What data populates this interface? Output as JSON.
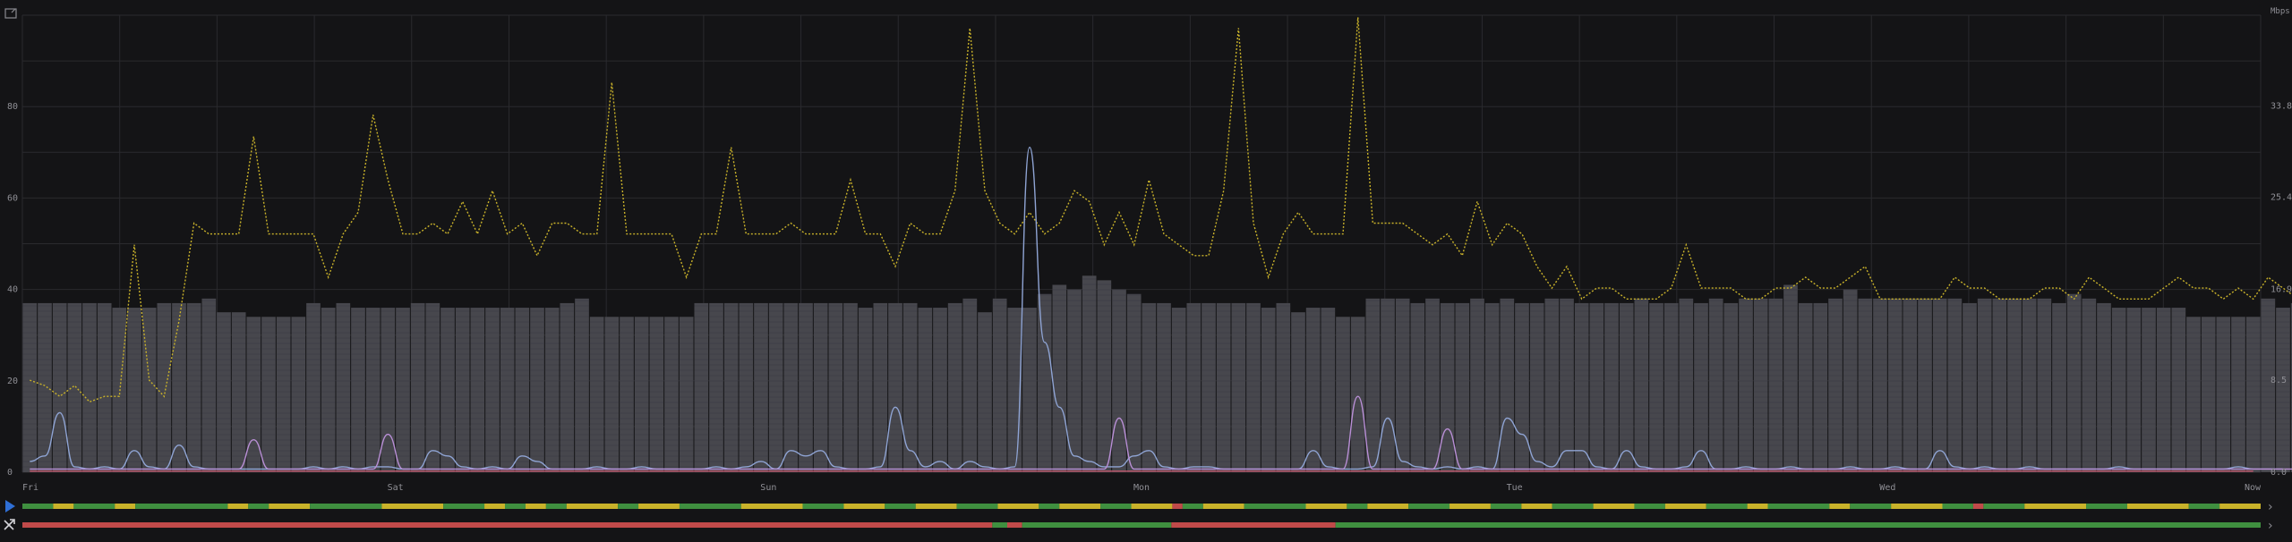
{
  "chart_data": {
    "type": "line",
    "x_labels": [
      "Fri",
      "Sat",
      "Sun",
      "Mon",
      "Tue",
      "Wed",
      "Now"
    ],
    "y_left": {
      "ticks": [
        "0",
        "20",
        "40",
        "60",
        "80"
      ],
      "range": [
        0,
        100
      ]
    },
    "y_right": {
      "label": "Mbps",
      "ticks": [
        "0.0",
        "8.5",
        "16.9",
        "25.4",
        "33.8"
      ],
      "range": [
        0,
        42.2
      ]
    },
    "grid": true,
    "n_points": 150,
    "series": [
      {
        "kind": "bars",
        "axis": "left",
        "color": "#47474d",
        "values": [
          37,
          37,
          37,
          37,
          37,
          37,
          36,
          36,
          36,
          37,
          37,
          37,
          38,
          35,
          35,
          34,
          34,
          34,
          34,
          37,
          36,
          37,
          36,
          36,
          36,
          36,
          37,
          37,
          36,
          36,
          36,
          36,
          36,
          36,
          36,
          36,
          37,
          38,
          34,
          34,
          34,
          34,
          34,
          34,
          34,
          37,
          37,
          37,
          37,
          37,
          37,
          37,
          37,
          37,
          37,
          37,
          36,
          37,
          37,
          37,
          36,
          36,
          37,
          38,
          35,
          38,
          36,
          36,
          39,
          41,
          40,
          43,
          42,
          40,
          39,
          37,
          37,
          36,
          37,
          37,
          37,
          37,
          37,
          36,
          37,
          35,
          36,
          36,
          34,
          34,
          38,
          38,
          38,
          37,
          38,
          37,
          37,
          38,
          37,
          38,
          37,
          37,
          38,
          38,
          37,
          37,
          37,
          37,
          38,
          37,
          37,
          38,
          37,
          38,
          37,
          38,
          38,
          38,
          41,
          37,
          37,
          38,
          40,
          38,
          38,
          38,
          38,
          38,
          38,
          38,
          37,
          38,
          38,
          38,
          38,
          38,
          37,
          39,
          38,
          37,
          36,
          36,
          36,
          36,
          36,
          34,
          34,
          34,
          34,
          34,
          38,
          36,
          37,
          37,
          37,
          37,
          37,
          37
        ]
      },
      {
        "kind": "line",
        "style": "dotted",
        "axis": "right",
        "color": "#c9b22a",
        "values": [
          8.5,
          8,
          7,
          8,
          6.5,
          7,
          7,
          21,
          8.5,
          7,
          14,
          23,
          22,
          22,
          22,
          31,
          22,
          22,
          22,
          22,
          18,
          22,
          24,
          33,
          27,
          22,
          22,
          23,
          22,
          25,
          22,
          26,
          22,
          23,
          20,
          23,
          23,
          22,
          22,
          36,
          22,
          22,
          22,
          22,
          18,
          22,
          22,
          30,
          22,
          22,
          22,
          23,
          22,
          22,
          22,
          27,
          22,
          22,
          19,
          23,
          22,
          22,
          26,
          41,
          26,
          23,
          22,
          24,
          22,
          23,
          26,
          25,
          21,
          24,
          21,
          27,
          22,
          21,
          20,
          20,
          26,
          41,
          23,
          18,
          22,
          24,
          22,
          22,
          22,
          42,
          23,
          23,
          23,
          22,
          21,
          22,
          20,
          25,
          21,
          23,
          22,
          19,
          17,
          19,
          16,
          17,
          17,
          16,
          16,
          16,
          17,
          21,
          17,
          17,
          17,
          16,
          16,
          17,
          17,
          18,
          17,
          17,
          18,
          19,
          16,
          16,
          16,
          16,
          16,
          18,
          17,
          17,
          16,
          16,
          16,
          17,
          17,
          16,
          18,
          17,
          16,
          16,
          16,
          17,
          18,
          17,
          17,
          16,
          17,
          16,
          18,
          17,
          16,
          15,
          16,
          17
        ]
      },
      {
        "kind": "line",
        "style": "solid",
        "axis": "right",
        "color": "#8fa4d4",
        "values": [
          1,
          1.5,
          5.5,
          0.5,
          0.3,
          0.5,
          0.3,
          2,
          0.5,
          0.3,
          2.5,
          0.5,
          0.3,
          0.3,
          0.3,
          0.3,
          0.3,
          0.3,
          0.3,
          0.5,
          0.3,
          0.5,
          0.3,
          0.5,
          0.5,
          0.3,
          0.3,
          2,
          1.5,
          0.5,
          0.3,
          0.5,
          0.3,
          1.5,
          1,
          0.3,
          0.3,
          0.3,
          0.5,
          0.3,
          0.3,
          0.5,
          0.3,
          0.3,
          0.3,
          0.3,
          0.5,
          0.3,
          0.5,
          1,
          0.3,
          2,
          1.5,
          2,
          0.5,
          0.3,
          0.3,
          0.5,
          6,
          2,
          0.5,
          1,
          0.3,
          1,
          0.5,
          0.3,
          0.5,
          30,
          12,
          6,
          1.5,
          1,
          0.5,
          0.5,
          1.5,
          2,
          0.5,
          0.3,
          0.5,
          0.5,
          0.3,
          0.3,
          0.3,
          0.3,
          0.3,
          0.3,
          2,
          0.5,
          0.3,
          0.3,
          0.5,
          5,
          1,
          0.5,
          0.3,
          0.5,
          0.3,
          0.5,
          0.3,
          5,
          3.5,
          1,
          0.5,
          2,
          2,
          0.5,
          0.3,
          2,
          0.5,
          0.3,
          0.3,
          0.5,
          2,
          0.3,
          0.3,
          0.5,
          0.3,
          0.3,
          0.5,
          0.3,
          0.3,
          0.3,
          0.5,
          0.3,
          0.3,
          0.5,
          0.3,
          0.3,
          2,
          0.5,
          0.3,
          0.5,
          0.3,
          0.3,
          0.5,
          0.3,
          0.3,
          0.3,
          0.3,
          0.3,
          0.5,
          0.3,
          0.3,
          0.3,
          0.3,
          0.3,
          0.3,
          0.3,
          0.5,
          0.3,
          0.3,
          0.3
        ]
      },
      {
        "kind": "line",
        "style": "solid",
        "axis": "right",
        "color": "#b98fd6",
        "values": [
          0.3,
          0.3,
          0.3,
          0.3,
          0.3,
          0.3,
          0.3,
          0.3,
          0.3,
          0.3,
          0.3,
          0.3,
          0.3,
          0.3,
          0.3,
          3,
          0.3,
          0.3,
          0.3,
          0.3,
          0.3,
          0.3,
          0.3,
          0.3,
          3.5,
          0.3,
          0.3,
          0.3,
          0.3,
          0.3,
          0.3,
          0.3,
          0.3,
          0.3,
          0.3,
          0.3,
          0.3,
          0.3,
          0.3,
          0.3,
          0.3,
          0.3,
          0.3,
          0.3,
          0.3,
          0.3,
          0.3,
          0.3,
          0.3,
          0.3,
          0.3,
          0.3,
          0.3,
          0.3,
          0.3,
          0.3,
          0.3,
          0.3,
          0.3,
          0.3,
          0.3,
          0.3,
          0.3,
          0.3,
          0.3,
          0.3,
          0.3,
          0.3,
          0.3,
          0.3,
          0.3,
          0.3,
          0.3,
          5,
          0.3,
          0.3,
          0.3,
          0.3,
          0.3,
          0.3,
          0.3,
          0.3,
          0.3,
          0.3,
          0.3,
          0.3,
          0.3,
          0.3,
          0.3,
          7,
          0.3,
          0.3,
          0.3,
          0.3,
          0.3,
          4,
          0.3,
          0.3,
          0.3,
          0.3,
          0.3,
          0.3,
          0.3,
          0.3,
          0.3,
          0.3,
          0.3,
          0.3,
          0.3,
          0.3,
          0.3,
          0.3,
          0.3,
          0.3,
          0.3,
          0.3,
          0.3,
          0.3,
          0.3,
          0.3,
          0.3,
          0.3,
          0.3,
          0.3,
          0.3,
          0.3,
          0.3,
          0.3,
          0.3,
          0.3,
          0.3,
          0.3,
          0.3,
          0.3,
          0.3,
          0.3,
          0.3,
          0.3,
          0.3,
          0.3,
          0.3,
          0.3,
          0.3,
          0.3,
          0.3,
          0.3,
          0.3,
          0.3,
          0.3,
          0.3,
          0.3,
          0.3,
          0.3
        ]
      },
      {
        "kind": "line",
        "style": "solid",
        "axis": "right",
        "color": "#c0566a",
        "values": [
          0.1,
          0.1,
          0.1,
          0.1,
          0.1,
          0.1,
          0.1,
          0.1,
          0.1,
          0.1,
          0.1,
          0.1,
          0.1,
          0.1,
          0.1,
          0.1,
          0.1,
          0.1,
          0.1,
          0.1,
          0.1,
          0.1,
          0.1,
          0.1,
          0.1,
          0.1,
          0.1,
          0.1,
          0.1,
          0.1,
          0.1,
          0.1,
          0.1,
          0.1,
          0.1,
          0.1,
          0.1,
          0.1,
          0.1,
          0.1,
          0.1,
          0.1,
          0.1,
          0.1,
          0.1,
          0.1,
          0.1,
          0.1,
          0.1,
          0.1,
          0.1,
          0.1,
          0.1,
          0.1,
          0.1,
          0.1,
          0.1,
          0.1,
          0.1,
          0.1,
          0.1,
          0.1,
          0.1,
          0.1,
          0.1,
          0.1,
          0.1,
          0.1,
          0.1,
          0.1,
          0.1,
          0.1,
          0.1,
          0.1,
          0.1,
          0.1,
          0.1,
          0.1,
          0.1,
          0.1,
          0.1,
          0.1,
          0.1,
          0.1,
          0.1,
          0.1,
          0.1,
          0.1,
          0.1,
          0.1,
          0.1,
          0.1,
          0.1,
          0.1,
          0.1,
          0.1,
          0.1,
          0.1,
          0.1,
          0.1,
          0.1,
          0.1,
          0.1,
          0.1,
          0.1,
          0.1,
          0.1,
          0.1,
          0.1,
          0.1,
          0.1,
          0.1,
          0.1,
          0.1,
          0.1,
          0.1,
          0.1,
          0.1,
          0.1,
          0.1,
          0.1,
          0.1,
          0.1,
          0.1,
          0.1,
          0.1,
          0.1,
          0.1,
          0.1,
          0.1,
          0.1,
          0.1,
          0.1,
          0.1,
          0.1,
          0.1,
          0.1,
          0.1,
          0.1,
          0.1,
          0.1,
          0.1,
          0.1,
          0.1,
          0.1,
          0.1,
          0.1,
          0.1,
          0.1,
          0.1
        ]
      }
    ],
    "status_lanes": [
      {
        "icon": "play-icon",
        "icon_color": "#2f6fd6",
        "segments": [
          [
            "#3f8f3f",
            3
          ],
          [
            "#c9b22a",
            2
          ],
          [
            "#3f8f3f",
            4
          ],
          [
            "#c9b22a",
            2
          ],
          [
            "#3f8f3f",
            9
          ],
          [
            "#c9b22a",
            2
          ],
          [
            "#3f8f3f",
            2
          ],
          [
            "#c9b22a",
            4
          ],
          [
            "#3f8f3f",
            7
          ],
          [
            "#c9b22a",
            6
          ],
          [
            "#3f8f3f",
            4
          ],
          [
            "#c9b22a",
            2
          ],
          [
            "#3f8f3f",
            2
          ],
          [
            "#c9b22a",
            2
          ],
          [
            "#3f8f3f",
            2
          ],
          [
            "#c9b22a",
            5
          ],
          [
            "#3f8f3f",
            2
          ],
          [
            "#c9b22a",
            4
          ],
          [
            "#3f8f3f",
            6
          ],
          [
            "#c9b22a",
            6
          ],
          [
            "#3f8f3f",
            4
          ],
          [
            "#c9b22a",
            4
          ],
          [
            "#3f8f3f",
            3
          ],
          [
            "#c9b22a",
            4
          ],
          [
            "#3f8f3f",
            4
          ],
          [
            "#c9b22a",
            4
          ],
          [
            "#3f8f3f",
            2
          ],
          [
            "#c9b22a",
            4
          ],
          [
            "#3f8f3f",
            3
          ],
          [
            "#c9b22a",
            4
          ],
          [
            "#c04a4a",
            1
          ],
          [
            "#3f8f3f",
            2
          ],
          [
            "#c9b22a",
            4
          ],
          [
            "#3f8f3f",
            6
          ],
          [
            "#c9b22a",
            4
          ],
          [
            "#3f8f3f",
            2
          ],
          [
            "#c9b22a",
            4
          ],
          [
            "#3f8f3f",
            4
          ],
          [
            "#c9b22a",
            4
          ],
          [
            "#3f8f3f",
            3
          ],
          [
            "#c9b22a",
            3
          ],
          [
            "#3f8f3f",
            4
          ],
          [
            "#c9b22a",
            4
          ],
          [
            "#3f8f3f",
            3
          ],
          [
            "#c9b22a",
            4
          ],
          [
            "#3f8f3f",
            4
          ],
          [
            "#c9b22a",
            2
          ],
          [
            "#3f8f3f",
            6
          ],
          [
            "#c9b22a",
            2
          ],
          [
            "#3f8f3f",
            4
          ],
          [
            "#c9b22a",
            5
          ],
          [
            "#3f8f3f",
            3
          ],
          [
            "#c04a4a",
            1
          ],
          [
            "#3f8f3f",
            4
          ],
          [
            "#c9b22a",
            6
          ],
          [
            "#3f8f3f",
            4
          ],
          [
            "#c9b22a",
            6
          ],
          [
            "#3f8f3f",
            3
          ],
          [
            "#c9b22a",
            4
          ]
        ]
      },
      {
        "icon": "shuffle-icon",
        "icon_color": "#d4d4d8",
        "segments": [
          [
            "#c04a4a",
            65
          ],
          [
            "#3f8f3f",
            1
          ],
          [
            "#c04a4a",
            1
          ],
          [
            "#3f8f3f",
            10
          ],
          [
            "#c04a4a",
            11
          ],
          [
            "#3f8f3f",
            62
          ]
        ]
      }
    ]
  },
  "controls": {
    "corner_icon": "expand-icon"
  }
}
